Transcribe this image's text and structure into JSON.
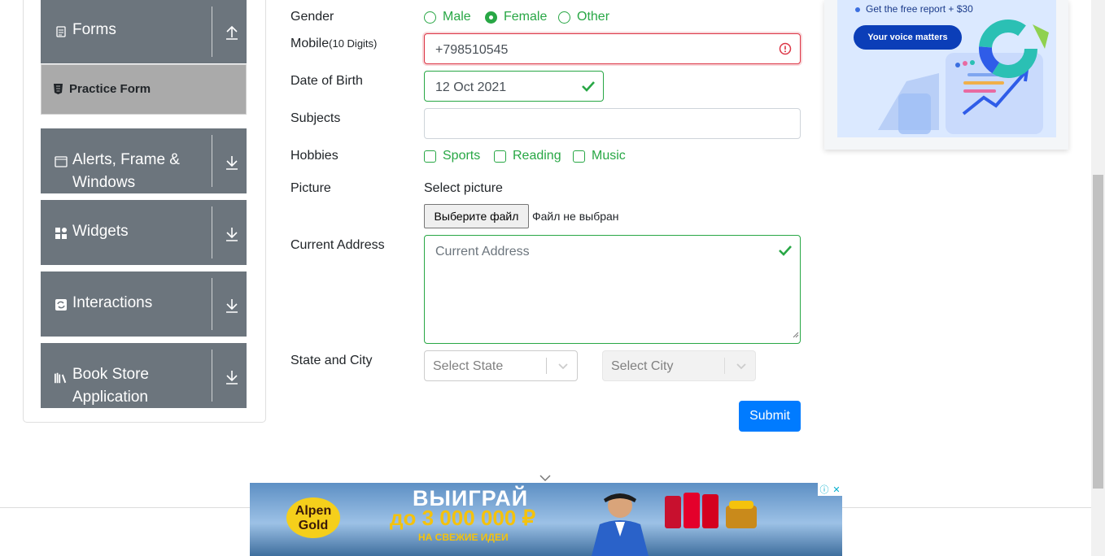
{
  "sidebar": {
    "forms": "Forms",
    "practice_form": "Practice Form",
    "alerts": "Alerts, Frame & Windows",
    "widgets": "Widgets",
    "interactions": "Interactions",
    "book_store": "Book Store Application"
  },
  "form": {
    "gender_label": "Gender",
    "gender_options": [
      "Male",
      "Female",
      "Other"
    ],
    "gender_selected": "Female",
    "mobile_label": "Mobile",
    "mobile_hint": "(10 Digits)",
    "mobile_value": "+798510545",
    "dob_label": "Date of Birth",
    "dob_value": "12 Oct 2021",
    "subjects_label": "Subjects",
    "subjects_value": "",
    "hobbies_label": "Hobbies",
    "hobbies": [
      "Sports",
      "Reading",
      "Music"
    ],
    "picture_label": "Picture",
    "picture_caption": "Select picture",
    "file_button": "Выберите файл",
    "file_status": "Файл не выбран",
    "address_label": "Current Address",
    "address_placeholder": "Current Address",
    "state_city_label": "State and City",
    "state_placeholder": "Select State",
    "city_placeholder": "Select City",
    "submit": "Submit"
  },
  "ad_top": {
    "text": "Get the free report + $30",
    "cta": "Your voice matters"
  },
  "ad_bottom": {
    "brand": "Alpen Gold",
    "headline": "ВЫИГРАЙ",
    "amount": "до 3 000 000 ₽",
    "sub": "НА СВЕЖИЕ ИДЕИ"
  },
  "colors": {
    "accent": "#28a745",
    "error": "#dc3545",
    "primary": "#007bff",
    "sidebar": "#6c757d"
  }
}
